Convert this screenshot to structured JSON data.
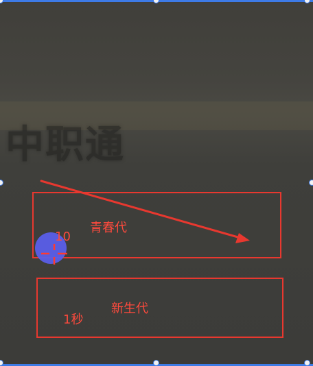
{
  "watermark": {
    "text": "中职通"
  },
  "boxes": {
    "youth": {
      "label": "青春代",
      "counter": "10"
    },
    "newborn": {
      "label": "新生代",
      "duration": "1秒"
    }
  },
  "colors": {
    "annotation": "#e8382f",
    "selection": "#3d7be6",
    "cursor": "#5a5ee8"
  },
  "icons": {
    "arrow": "arrow-icon",
    "crosshair": "crosshair-icon"
  }
}
